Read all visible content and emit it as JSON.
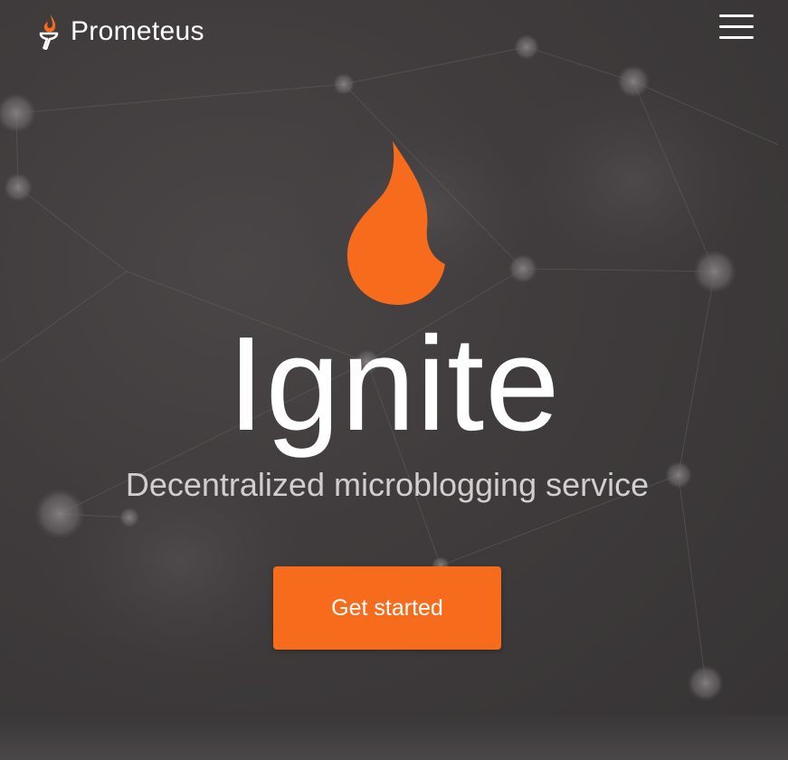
{
  "header": {
    "brand_name": "Prometeus",
    "brand_icon": "torch-flame-icon",
    "menu_icon": "hamburger-menu-icon"
  },
  "hero": {
    "logo_icon": "flame-icon",
    "headline": "Ignite",
    "tagline": "Decentralized microblogging service",
    "cta_label": "Get started"
  },
  "colors": {
    "accent": "#f76b1c",
    "background": "#3a3738",
    "text_primary": "#ffffff",
    "text_secondary": "#d0cecf"
  }
}
